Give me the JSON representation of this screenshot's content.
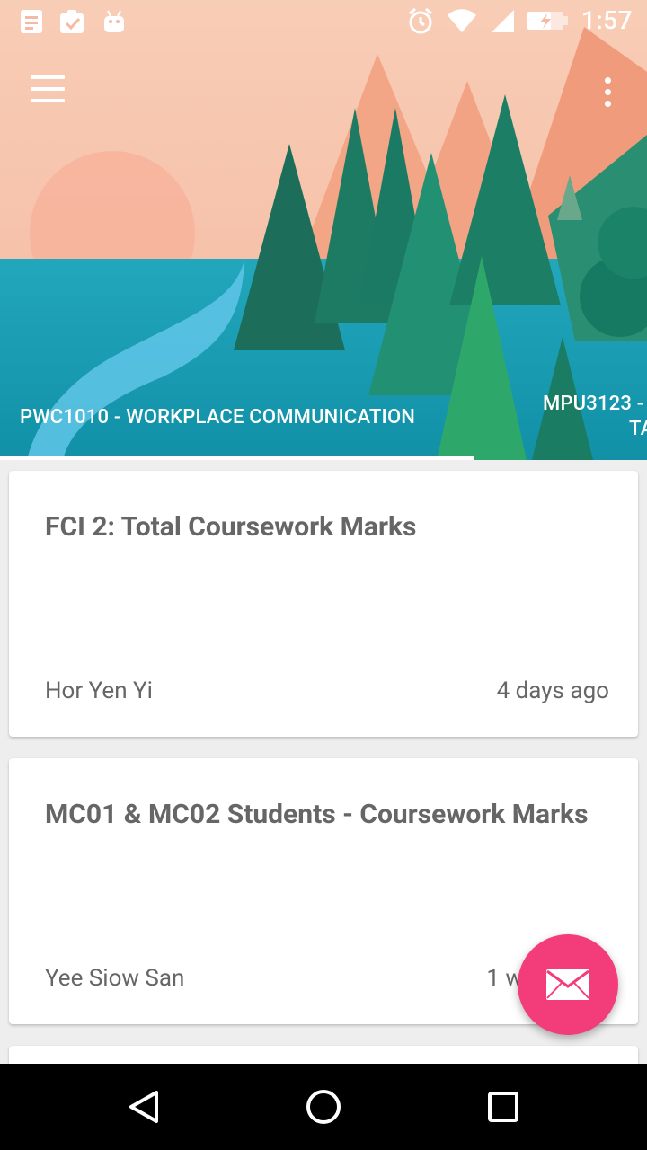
{
  "status_bar": {
    "time": "1:57",
    "icons": [
      "notes-icon",
      "clipboard-check-icon",
      "android-icon",
      "alarm-icon",
      "wifi-icon",
      "signal-icon",
      "battery-charging-icon"
    ]
  },
  "toolbar": {
    "menu_icon": "hamburger-menu-icon",
    "more_icon": "more-vert-icon"
  },
  "tabs": [
    {
      "label": "PWC1010 - WORKPLACE COMMUNICATION",
      "active": true
    },
    {
      "label": "MPU3123 -",
      "label_line2": "TA",
      "active": false
    }
  ],
  "cards": [
    {
      "title": "FCI 2: Total Coursework Marks",
      "author": "Hor Yen Yi",
      "time": "4 days ago"
    },
    {
      "title": "MC01 & MC02 Students - Coursework Marks",
      "author": "Yee Siow San",
      "time": "1 w"
    }
  ],
  "fab": {
    "icon": "mail-icon"
  },
  "nav_bar": {
    "icons": [
      "back-icon",
      "home-icon",
      "recents-icon"
    ]
  },
  "colors": {
    "sky": "#f6c3ad",
    "water": "#1e9fb6",
    "trees": "#1a7a63",
    "fab": "#f23d7a"
  }
}
